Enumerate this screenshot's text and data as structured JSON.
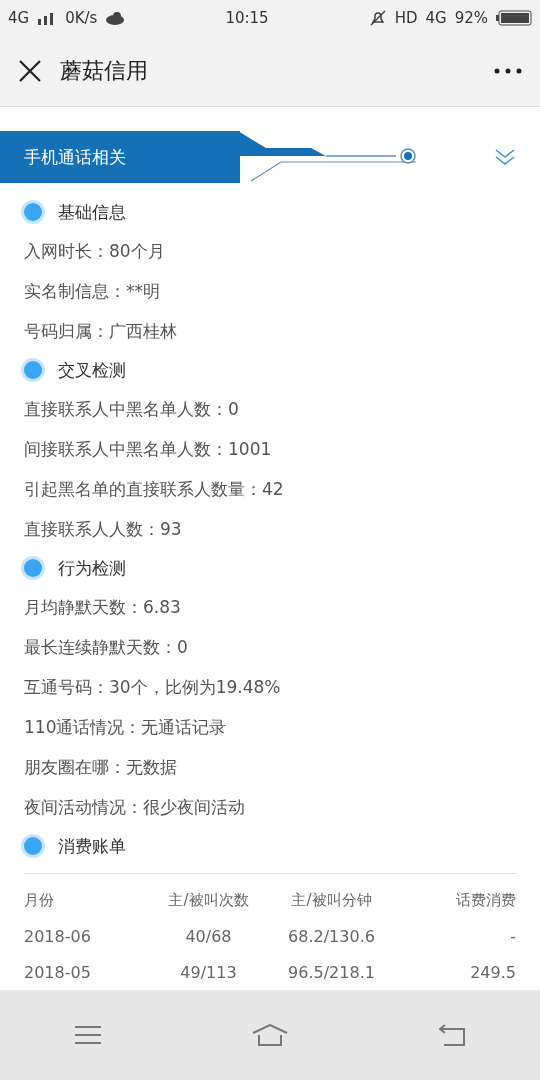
{
  "status_bar": {
    "network": "4G",
    "speed": "0K/s",
    "time": "10:15",
    "hd": "HD",
    "network_right": "4G",
    "battery": "92%"
  },
  "header": {
    "title": "蘑菇信用"
  },
  "section": {
    "title": "手机通话相关",
    "expanded": true
  },
  "groups": [
    {
      "title": "基础信息",
      "items": [
        "入网时长：80个月",
        "实名制信息：**明",
        "号码归属：广西桂林"
      ]
    },
    {
      "title": "交叉检测",
      "items": [
        "直接联系人中黑名单人数：0",
        "间接联系人中黑名单人数：1001",
        "引起黑名单的直接联系人数量：42",
        "直接联系人人数：93"
      ]
    },
    {
      "title": "行为检测",
      "items": [
        "月均静默天数：6.83",
        "最长连续静默天数：0",
        "互通号码：30个，比例为19.48%",
        "110通话情况：无通话记录",
        "朋友圈在哪：无数据",
        "夜间活动情况：很少夜间活动"
      ]
    },
    {
      "title": "消费账单"
    }
  ],
  "table": {
    "columns": [
      "月份",
      "主/被叫次数",
      "主/被叫分钟",
      "话费消费"
    ],
    "rows": [
      [
        "2018-06",
        "40/68",
        "68.2/130.6",
        "-"
      ],
      [
        "2018-05",
        "49/113",
        "96.5/218.1",
        "249.5"
      ]
    ]
  }
}
